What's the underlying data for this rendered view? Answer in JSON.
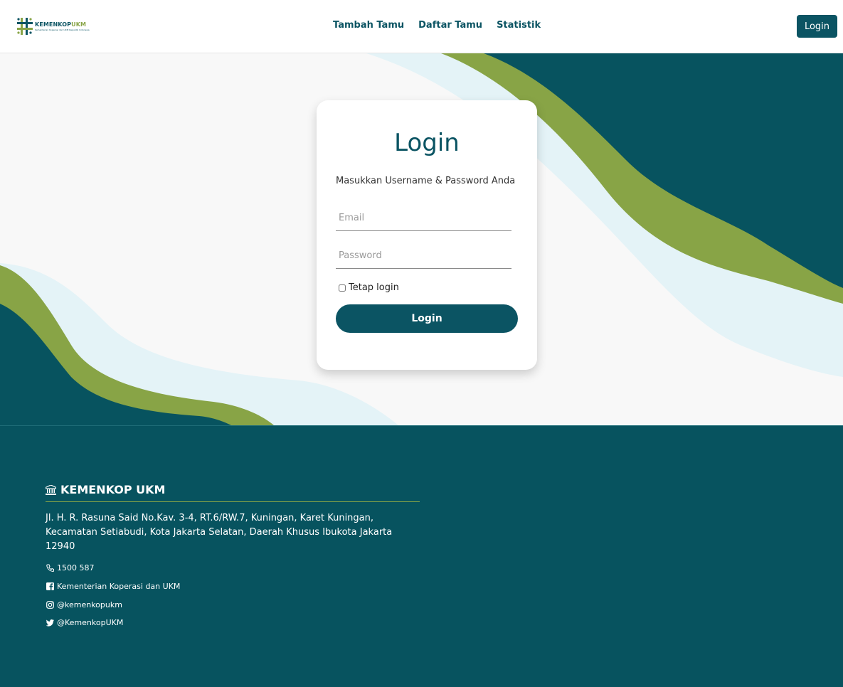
{
  "header": {
    "logo_title_1": "KEMENKOP",
    "logo_title_2": "UKM",
    "logo_subtitle": "Kementerian Koperasi dan UKM Republik Indonesia",
    "nav": [
      {
        "label": "Tambah Tamu"
      },
      {
        "label": "Daftar Tamu"
      },
      {
        "label": "Statistik"
      }
    ],
    "login_button": "Login"
  },
  "login_card": {
    "title": "Login",
    "subtitle": "Masukkan Username & Password Anda",
    "email_placeholder": "Email",
    "password_placeholder": "Password",
    "remember_label": "Tetap login",
    "submit_label": "Login"
  },
  "footer": {
    "title": "KEMENKOP UKM",
    "address": "Jl. H. R. Rasuna Said No.Kav. 3-4, RT.6/RW.7, Kuningan, Karet Kuningan, Kecamatan Setiabudi, Kota Jakarta Selatan, Daerah Khusus Ibukota Jakarta 12940",
    "phone": "1500 587",
    "facebook": "Kementerian Koperasi dan UKM",
    "instagram": "@kemenkopukm",
    "twitter": "@KemenkopUKM"
  },
  "colors": {
    "primary": "#0b5463",
    "accent": "#88a446",
    "light_wave": "#e4f3f7"
  },
  "icons": [
    "building-icon",
    "phone-icon",
    "facebook-icon",
    "instagram-icon",
    "twitter-icon"
  ]
}
